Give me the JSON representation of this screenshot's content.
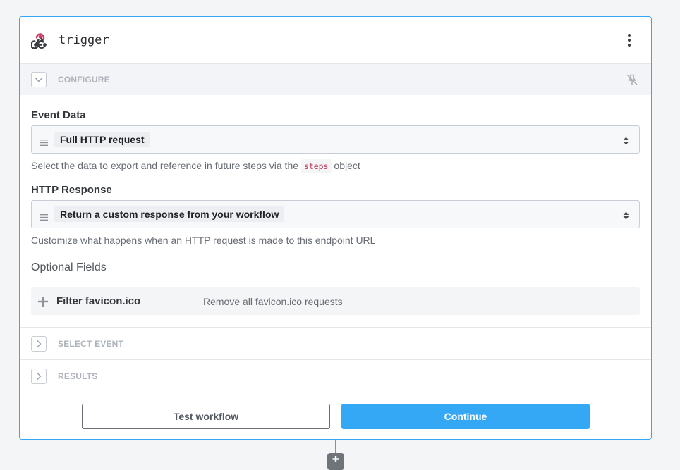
{
  "step": {
    "title": "trigger",
    "icon": "webhook-icon"
  },
  "configure": {
    "label": "CONFIGURE"
  },
  "event_data": {
    "label": "Event Data",
    "value": "Full HTTP request",
    "help_prefix": "Select the data to export and reference in future steps via the",
    "help_code": "steps",
    "help_suffix": "object"
  },
  "http_response": {
    "label": "HTTP Response",
    "value": "Return a custom response from your workflow",
    "help": "Customize what happens when an HTTP request is made to this endpoint URL"
  },
  "optional_fields": {
    "title": "Optional Fields",
    "items": [
      {
        "name": "Filter favicon.ico",
        "description": "Remove all favicon.ico requests"
      }
    ]
  },
  "sections": {
    "select_event": "SELECT EVENT",
    "results": "RESULTS"
  },
  "footer": {
    "test_label": "Test workflow",
    "continue_label": "Continue"
  },
  "colors": {
    "accent": "#35a8f5",
    "icon_red": "#c73a63"
  }
}
